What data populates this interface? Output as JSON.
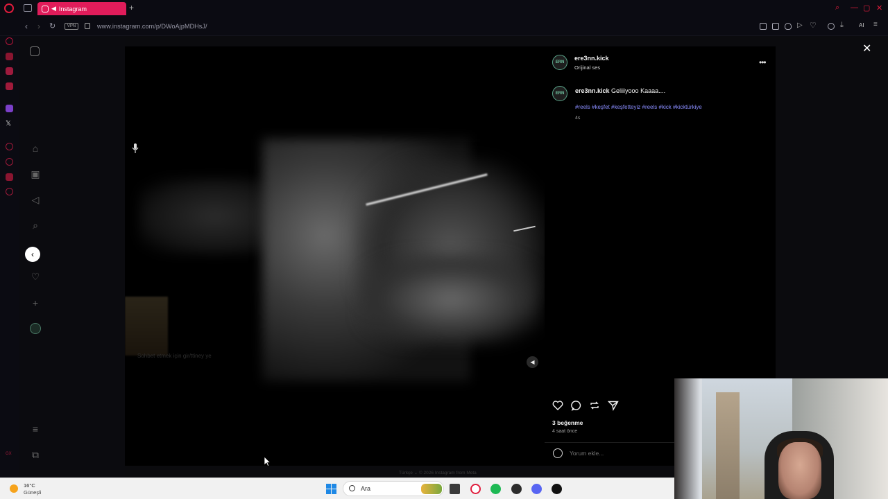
{
  "browser": {
    "tab_title": "Instagram",
    "url": "www.instagram.com/p/DWoAjpMDHsJ/",
    "vpn_label": "VPN",
    "ai_label": "AI",
    "accent": "#e01c5a"
  },
  "post": {
    "username": "ere3nn.kick",
    "audio": "Orijinal ses",
    "avatar_text": "ERN",
    "caption_user": "ere3nn.kick",
    "caption_text": "Geliiiyooo Kaaaa....",
    "hashtags": "#reels #keşfet #keşfetteyiz #reels #kick #kicktürkiye",
    "caption_age": "4s",
    "likes": "3 beğenme",
    "posted_ago": "4 saat önce",
    "comment_placeholder": "Yorum ekle...",
    "hashtag_color": "#8a8dff"
  },
  "video": {
    "overlay_text": "Sohbet etmek için gir/ttiney ye"
  },
  "footer": {
    "language": "Türkçe",
    "copyright": "© 2026 Instagram from Meta"
  },
  "taskbar": {
    "temperature": "16°C",
    "weather": "Güneşli",
    "search_label": "Ara"
  }
}
